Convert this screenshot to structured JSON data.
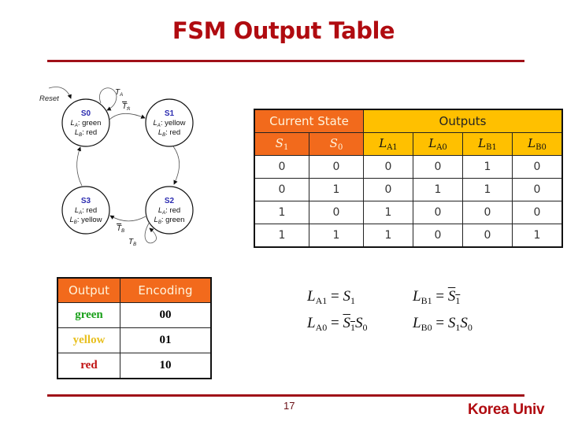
{
  "slide": {
    "title": "FSM Output Table",
    "page_number": "17",
    "footer_brand": "Korea Univ"
  },
  "colors": {
    "title": "#b00b10",
    "rule": "#a01018",
    "current_state_header": "#f26a1c",
    "outputs_header": "#ffc000",
    "state_label": "#2b2bb0",
    "green": "#1aa01a",
    "yellow": "#e8c020",
    "red": "#c01010"
  },
  "fsm_diagram": {
    "reset_label": "Reset",
    "states": [
      {
        "name": "S0",
        "la_label": "L",
        "la_sub": "A",
        "la_value": ": green",
        "lb_label": "L",
        "lb_sub": "B",
        "lb_value": ": red"
      },
      {
        "name": "S1",
        "la_label": "L",
        "la_sub": "A",
        "la_value": ": yellow",
        "lb_label": "L",
        "lb_sub": "B",
        "lb_value": ": red"
      },
      {
        "name": "S2",
        "la_label": "L",
        "la_sub": "A",
        "la_value": ": red",
        "lb_label": "L",
        "lb_sub": "B",
        "lb_value": ": green"
      },
      {
        "name": "S3",
        "la_label": "L",
        "la_sub": "A",
        "la_value": ": red",
        "lb_label": "L",
        "lb_sub": "B",
        "lb_value": ": yellow"
      }
    ],
    "transitions": [
      {
        "from": "S0",
        "to": "S0",
        "label": "T",
        "sub": "A",
        "negated": false
      },
      {
        "from": "S0",
        "to": "S1",
        "label": "T",
        "sub": "A",
        "negated": true
      },
      {
        "from": "S1",
        "to": "S2",
        "label": "",
        "sub": "",
        "negated": false
      },
      {
        "from": "S2",
        "to": "S2",
        "label": "T",
        "sub": "B",
        "negated": false
      },
      {
        "from": "S2",
        "to": "S3",
        "label": "T",
        "sub": "B",
        "negated": true
      },
      {
        "from": "S3",
        "to": "S0",
        "label": "",
        "sub": "",
        "negated": false
      }
    ]
  },
  "output_table": {
    "group_headers": [
      "Current State",
      "Outputs"
    ],
    "columns": [
      {
        "base": "S",
        "sub": "1"
      },
      {
        "base": "S",
        "sub": "0"
      },
      {
        "base": "L",
        "sub": "A1"
      },
      {
        "base": "L",
        "sub": "A0"
      },
      {
        "base": "L",
        "sub": "B1"
      },
      {
        "base": "L",
        "sub": "B0"
      }
    ],
    "rows": [
      [
        "0",
        "0",
        "0",
        "0",
        "1",
        "0"
      ],
      [
        "0",
        "1",
        "0",
        "1",
        "1",
        "0"
      ],
      [
        "1",
        "0",
        "1",
        "0",
        "0",
        "0"
      ],
      [
        "1",
        "1",
        "1",
        "0",
        "0",
        "1"
      ]
    ]
  },
  "encoding_table": {
    "headers": [
      "Output",
      "Encoding"
    ],
    "rows": [
      {
        "output": "green",
        "encoding": "00"
      },
      {
        "output": "yellow",
        "encoding": "01"
      },
      {
        "output": "red",
        "encoding": "10"
      }
    ]
  },
  "equations": [
    {
      "lhs": "L",
      "lhs_sub": "A1",
      "eq": "=",
      "terms": [
        {
          "base": "S",
          "sub": "1",
          "bar": false
        }
      ]
    },
    {
      "lhs": "L",
      "lhs_sub": "B1",
      "eq": "=",
      "terms": [
        {
          "base": "S",
          "sub": "1",
          "bar": true
        }
      ]
    },
    {
      "lhs": "L",
      "lhs_sub": "A0",
      "eq": "=",
      "terms": [
        {
          "base": "S",
          "sub": "1",
          "bar": true
        },
        {
          "base": "S",
          "sub": "0",
          "bar": false
        }
      ]
    },
    {
      "lhs": "L",
      "lhs_sub": "B0",
      "eq": "=",
      "terms": [
        {
          "base": "S",
          "sub": "1",
          "bar": false
        },
        {
          "base": "S",
          "sub": "0",
          "bar": false
        }
      ]
    }
  ]
}
